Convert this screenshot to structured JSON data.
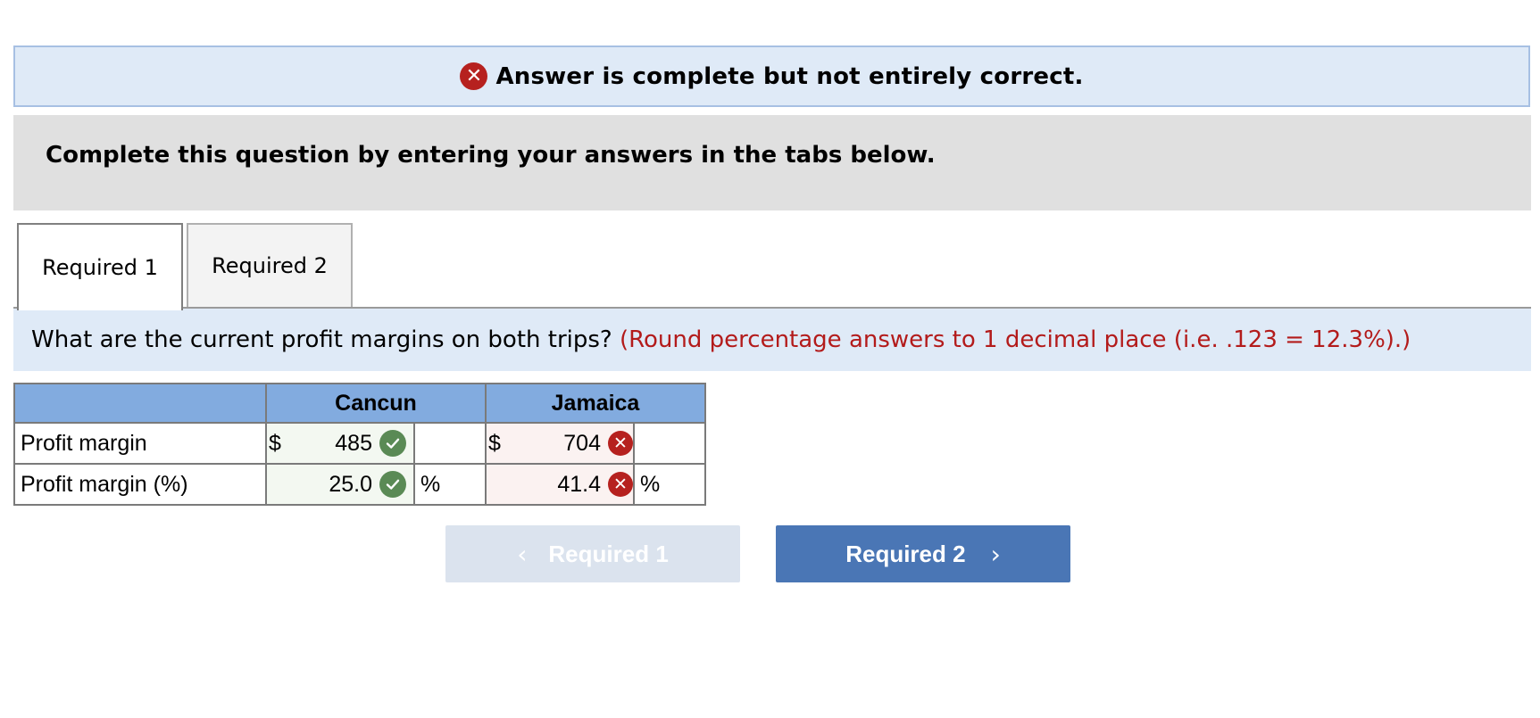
{
  "banner": {
    "icon": "x-circle-icon",
    "text": "Answer is complete but not entirely correct."
  },
  "instruction": "Complete this question by entering your answers in the tabs below.",
  "tabs": [
    {
      "label": "Required 1",
      "active": true
    },
    {
      "label": "Required 2",
      "active": false
    }
  ],
  "question": {
    "text": "What are the current profit margins on both trips?",
    "hint": "(Round percentage answers to 1 decimal place (i.e. .123 = 12.3%).)"
  },
  "table": {
    "headers": [
      "",
      "Cancun",
      "Jamaica"
    ],
    "rows": [
      {
        "label": "Profit margin",
        "cancun": {
          "prefix": "$",
          "value": "485",
          "status": "correct",
          "unit": ""
        },
        "jamaica": {
          "prefix": "$",
          "value": "704",
          "status": "incorrect",
          "unit": ""
        }
      },
      {
        "label": "Profit margin (%)",
        "cancun": {
          "prefix": "",
          "value": "25.0",
          "status": "correct",
          "unit": "%"
        },
        "jamaica": {
          "prefix": "",
          "value": "41.4",
          "status": "incorrect",
          "unit": "%"
        }
      }
    ]
  },
  "nav": {
    "prev_label": "Required 1",
    "next_label": "Required 2",
    "prev_icon": "chevron-left-icon",
    "next_icon": "chevron-right-icon"
  },
  "colors": {
    "correct": "#5a8a55",
    "incorrect": "#b6211f",
    "header": "#82abdf",
    "nav_active": "#4a76b5",
    "nav_disabled": "#dbe3ee",
    "hint": "#b31b1b"
  }
}
